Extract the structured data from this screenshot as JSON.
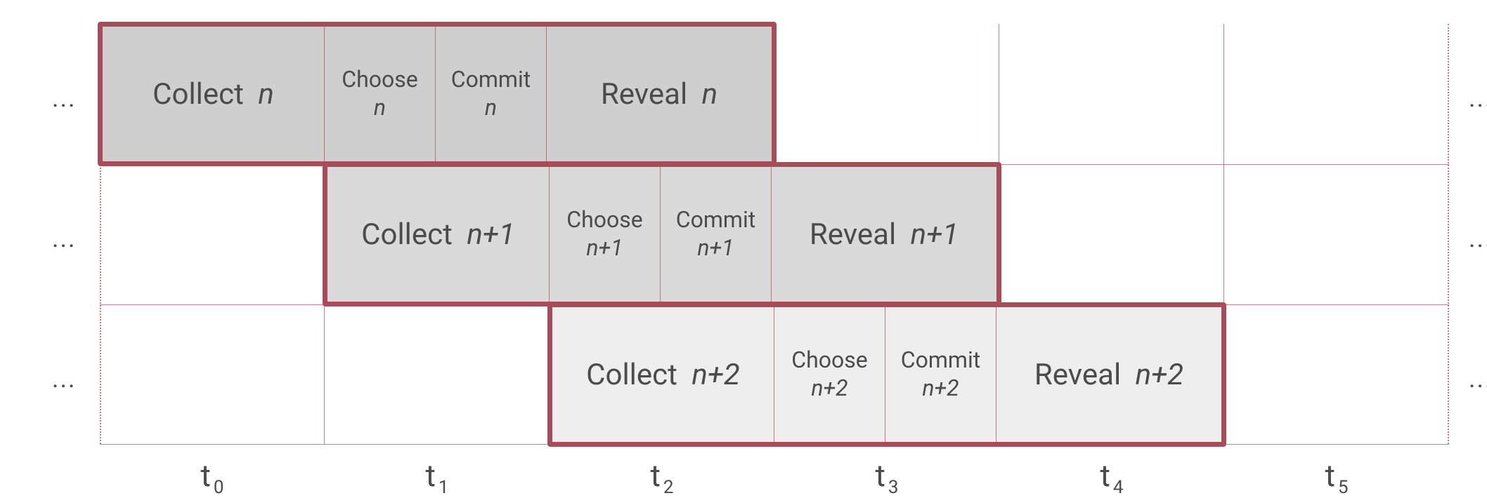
{
  "ellipsis": "...",
  "ticks": [
    "t",
    "t",
    "t",
    "t",
    "t",
    "t"
  ],
  "ticks_sub": [
    "0",
    "1",
    "2",
    "3",
    "4",
    "5"
  ],
  "rows": [
    {
      "collect_word": "Collect",
      "collect_expr": "n",
      "choose_word": "Choose",
      "choose_expr": "n",
      "commit_word": "Commit",
      "commit_expr": "n",
      "reveal_word": "Reveal",
      "reveal_expr": "n"
    },
    {
      "collect_word": "Collect",
      "collect_expr": "n+1",
      "choose_word": "Choose",
      "choose_expr": "n+1",
      "commit_word": "Commit",
      "commit_expr": "n+1",
      "reveal_word": "Reveal",
      "reveal_expr": "n+1"
    },
    {
      "collect_word": "Collect",
      "collect_expr": "n+2",
      "choose_word": "Choose",
      "choose_expr": "n+2",
      "commit_word": "Commit",
      "commit_expr": "n+2",
      "reveal_word": "Reveal",
      "reveal_expr": "n+2"
    }
  ]
}
